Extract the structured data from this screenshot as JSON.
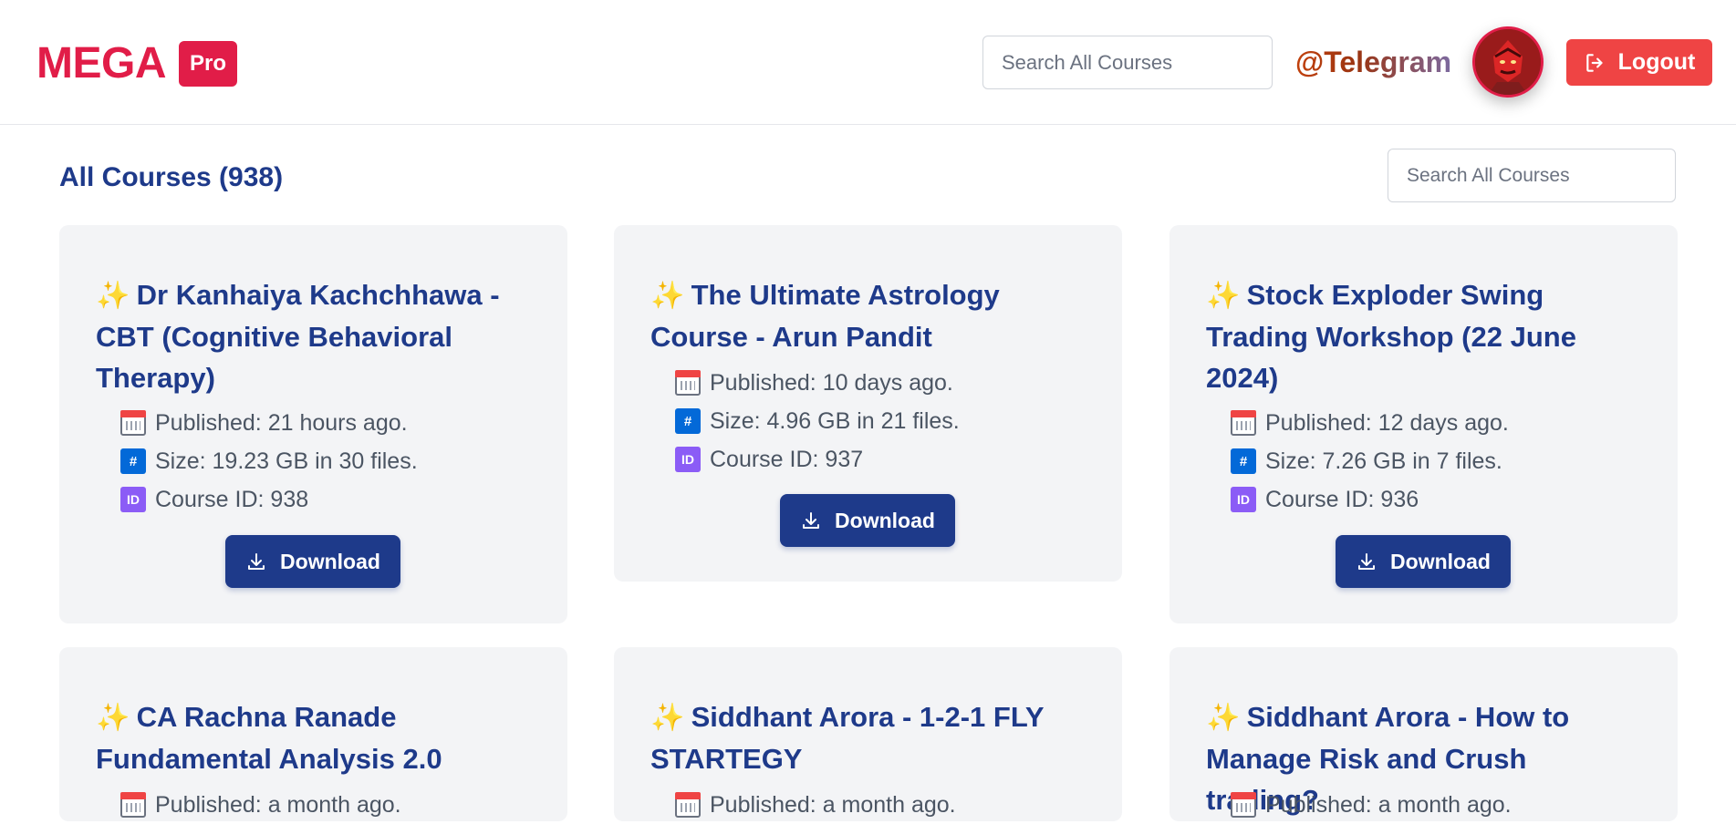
{
  "header": {
    "logo_text": "MEGA",
    "logo_badge": "Pro",
    "search_placeholder": "Search All Courses",
    "telegram": "@Telegram",
    "logout": "Logout"
  },
  "main": {
    "title": "All Courses (938)",
    "search_placeholder": "Search All Courses"
  },
  "courses": [
    {
      "sparkle": "✨",
      "title": "Dr Kanhaiya Kachchhawa - CBT (Cognitive Behavioral Therapy)",
      "published": "Published: 21 hours ago.",
      "size": "Size: 19.23 GB in 30 files.",
      "id": "Course ID: 938",
      "download": "Download"
    },
    {
      "sparkle": "✨",
      "title": "The Ultimate Astrology Course - Arun Pandit",
      "published": "Published: 10 days ago.",
      "size": "Size: 4.96 GB in 21 files.",
      "id": "Course ID: 937",
      "download": "Download"
    },
    {
      "sparkle": "✨",
      "title": "Stock Exploder Swing Trading Workshop (22 June 2024)",
      "published": "Published: 12 days ago.",
      "size": "Size: 7.26 GB in 7 files.",
      "id": "Course ID: 936",
      "download": "Download"
    },
    {
      "sparkle": "✨",
      "title": "CA Rachna Ranade Fundamental Analysis 2.0",
      "published": "Published: a month ago."
    },
    {
      "sparkle": "✨",
      "title": "Siddhant Arora - 1-2-1 FLY STARTEGY",
      "published": "Published: a month ago."
    },
    {
      "sparkle": "✨",
      "title": "Siddhant Arora - How to Manage Risk and Crush trading?",
      "published": "Published: a month ago."
    }
  ],
  "icons": {
    "hash": "#",
    "id": "ID"
  }
}
